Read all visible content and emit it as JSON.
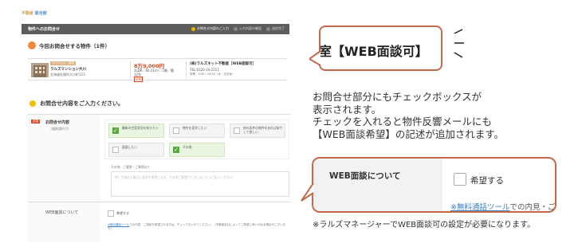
{
  "left_panel": {
    "brand": "不動産 ",
    "brand_accent": "総合館",
    "form_title": "物件へのお問合せ",
    "steps": [
      "お問合せ内容のご入力",
      "入力内容の確認",
      "送信完了"
    ],
    "property_heading": "今回お問合せする物件（1件）",
    "property": {
      "tag": "マンション・賃貸",
      "name": "ラルズマンション大川",
      "address": "北海道札幌市大川町123",
      "price": "8万9,000円",
      "detail": "2LDK／60.21m²／2階／築12年",
      "badge": "空室",
      "company": "(株)ラルズネット不動産［WEB面談可］",
      "tel": "TEL:0120-34-2211",
      "hours": "営業：9:00〜18:00（水・日定休）"
    },
    "inquiry_heading": "お問合せ内容をご入力ください。",
    "inquiry_row": {
      "required_badge": "必須",
      "label": "お問合せ内容",
      "sub": "（複数選択可）",
      "options": [
        {
          "label": "最新の空室状況を知りたい",
          "checked": true
        },
        {
          "label": "物件を見学したい",
          "checked": false
        },
        {
          "label": "他の条件の物件をあれば紹介して欲しい",
          "checked": false
        },
        {
          "label": "画面したい",
          "checked": false
        },
        {
          "label": "その他",
          "checked": true
        }
      ],
      "other_label": "その他、ご要望・ご質問など",
      "other_placeholder": "例）今週の土曜日に見学を希望します。その他ご要望がございましたらご記入ください。"
    },
    "web_row": {
      "label": "WEB面談について",
      "checkbox_label": "希望する",
      "note_link": "※無料通話ツール",
      "note_rest": "での内見・ご相談を希望される方は、チェックを入れてください。（不動産会社によってご希望に添いかねる場合がございます）"
    }
  },
  "callout": {
    "text": "室【WEB面談可】"
  },
  "description": {
    "line1": "お問合せ部分にもチェックボックスが",
    "line2": "表示されます。",
    "line3": "チェックを入れると物件反響メールにも",
    "line4": "【WEB面談希望】の記述が追加されます。"
  },
  "bubble": {
    "label": "WEB面談について",
    "checkbox_label": "希望する",
    "note_link": "※無料通話ツール",
    "note_rest": "での内見・ご"
  },
  "footnote": "※ラルズマネージャーでWEB面談可の設定が必要になります。",
  "colors": {
    "accent_border": "#c46a4a",
    "price_red": "#e2481d",
    "check_green": "#59a840",
    "link_blue": "#3b7fc4"
  }
}
